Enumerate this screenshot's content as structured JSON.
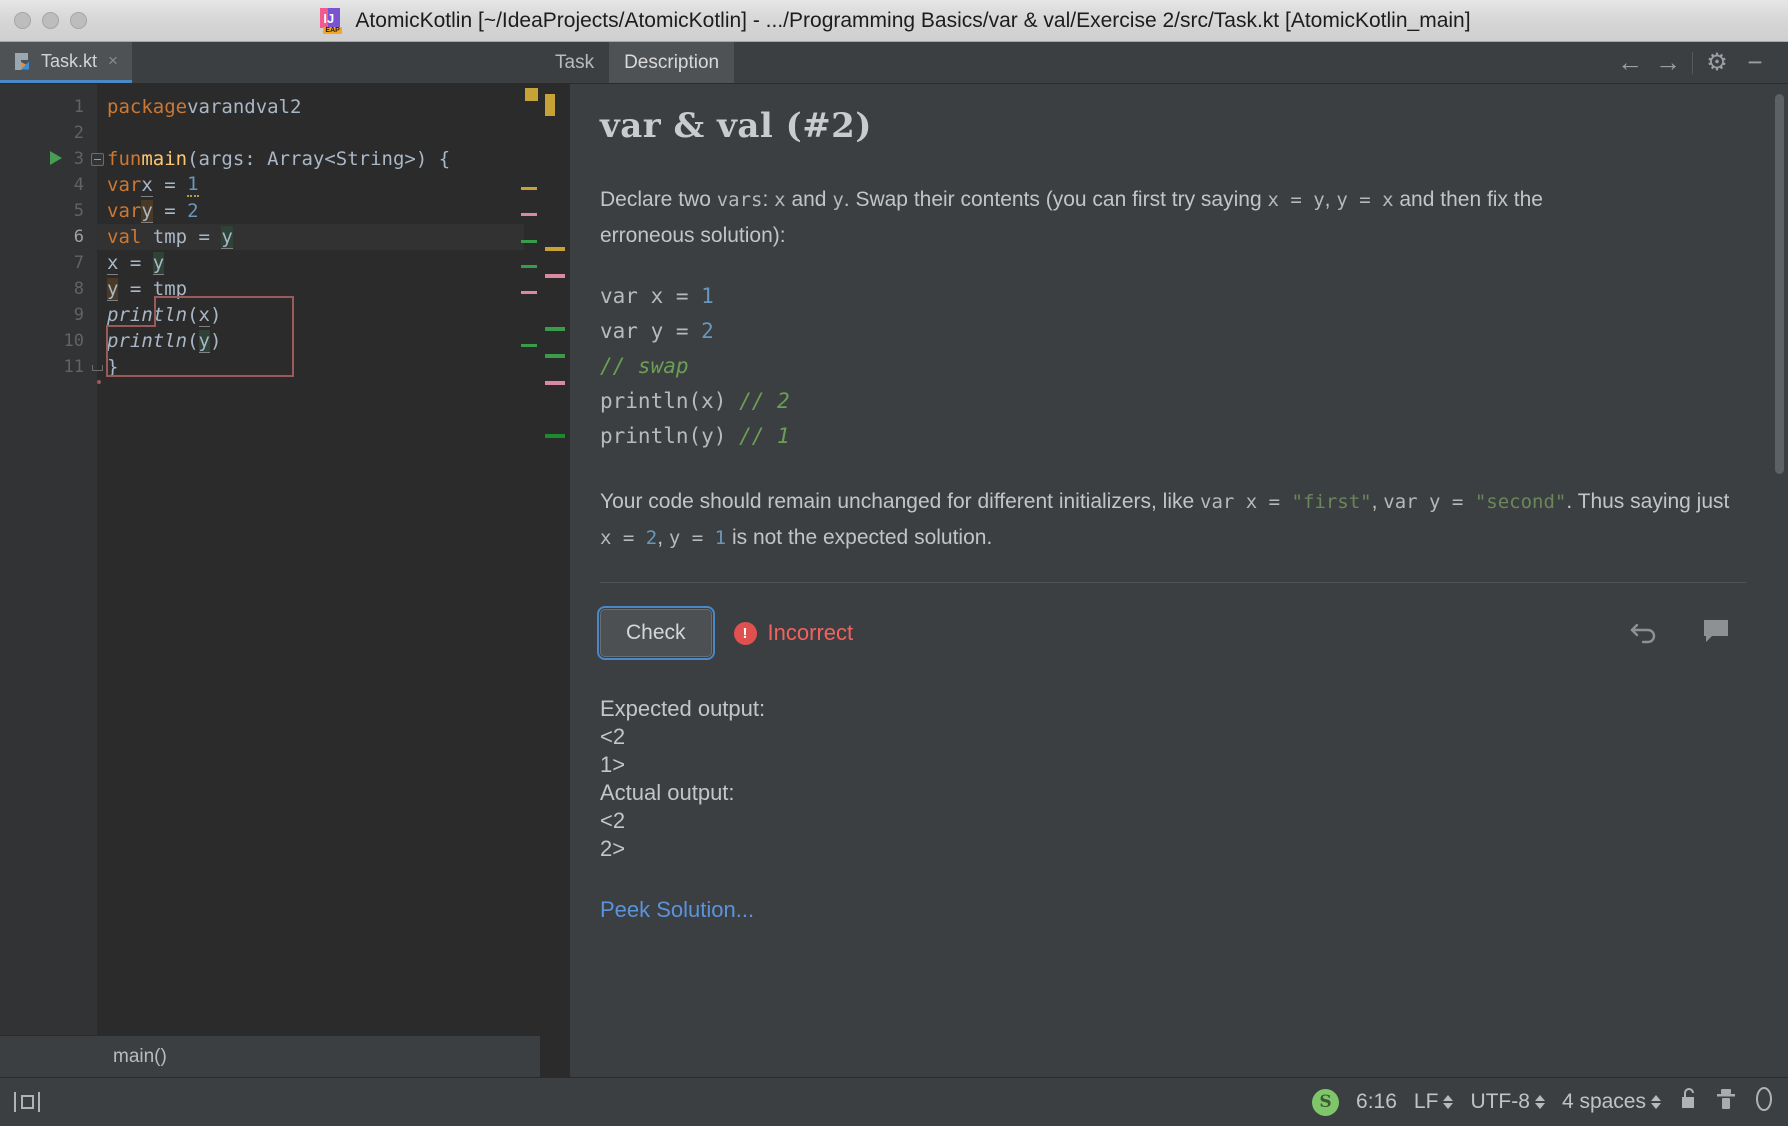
{
  "window": {
    "title": "AtomicKotlin [~/IdeaProjects/AtomicKotlin] - .../Programming Basics/var & val/Exercise 2/src/Task.kt [AtomicKotlin_main]",
    "app_icon": "intellij-idea-eap-icon",
    "traffic_lights": [
      "close-button",
      "minimize-button",
      "zoom-button"
    ]
  },
  "editor": {
    "tab": {
      "label": "Task.kt",
      "icon": "kotlin-file-icon",
      "close": "×"
    },
    "lines": [
      {
        "n": "1",
        "text": "package varandval2"
      },
      {
        "n": "2",
        "text": ""
      },
      {
        "n": "3",
        "text": "fun main(args: Array<String>) {"
      },
      {
        "n": "4",
        "text": "    var x = 1"
      },
      {
        "n": "5",
        "text": "    var y = 2"
      },
      {
        "n": "6",
        "text": "    val tmp = y"
      },
      {
        "n": "7",
        "text": "    x = y"
      },
      {
        "n": "8",
        "text": "    y = tmp"
      },
      {
        "n": "9",
        "text": "    println(x)"
      },
      {
        "n": "10",
        "text": "    println(y)"
      },
      {
        "n": "11",
        "text": "}"
      }
    ],
    "breadcrumb": "main()",
    "current_line": "6"
  },
  "task_panel": {
    "tabs": [
      {
        "label": "Task",
        "active": false
      },
      {
        "label": "Description",
        "active": true
      }
    ],
    "actions": [
      {
        "name": "back-arrow-icon",
        "glyph": "←"
      },
      {
        "name": "forward-arrow-icon",
        "glyph": "→"
      },
      {
        "name": "gear-icon",
        "glyph": "⚙"
      },
      {
        "name": "minimize-icon",
        "glyph": "−"
      }
    ],
    "title": "var & val (#2)",
    "paragraph1": {
      "p1": "Declare two ",
      "m1": "vars",
      "p2": ": ",
      "m2": "x",
      "p3": " and ",
      "m3": "y",
      "p4": ". Swap their contents (you can first try saying ",
      "m4": "x = y",
      "p5": ", ",
      "m5": "y = x",
      "p6": " and then fix the erroneous solution):"
    },
    "code_block": [
      {
        "code": "var x = ",
        "num": "1",
        "comment": ""
      },
      {
        "code": "var y = ",
        "num": "2",
        "comment": ""
      },
      {
        "code": "",
        "num": "",
        "comment": "// swap"
      },
      {
        "code": "println(x) ",
        "num": "",
        "comment": "// 2"
      },
      {
        "code": "println(y) ",
        "num": "",
        "comment": "// 1"
      }
    ],
    "paragraph2": {
      "p1": "Your code should remain unchanged for different initializers, like ",
      "m1": "var x = ",
      "s1": "\"first\"",
      "p2": ", ",
      "m2": "var y = ",
      "s2": "\"second\"",
      "p3": ". Thus saying just ",
      "m3": "x = ",
      "n1": "2",
      "p4": ", ",
      "m4": "y = ",
      "n2": "1",
      "p5": " is not the expected solution."
    },
    "check_button": "Check",
    "status": {
      "text": "Incorrect",
      "icon": "error-exclamation-icon",
      "color": "#f4615f"
    },
    "reset_icon": "undo-arrow-icon",
    "comment_icon": "comment-bubble-icon",
    "output": [
      "Expected output:",
      "<2",
      "1>",
      "Actual output:",
      "<2",
      "2>"
    ],
    "peek_solution": "Peek Solution..."
  },
  "statusbar": {
    "window_toggle_icon": "tool-window-toggle-icon",
    "kotlin_badge": "kotlin-status-icon",
    "caret_position": "6:16",
    "line_separator": "LF",
    "encoding": "UTF-8",
    "indent": "4 spaces",
    "lock_icon": "unlocked-padlock-icon",
    "inspector_icon": "inspection-detective-icon",
    "memory_icon": "memory-indicator-icon"
  },
  "colors": {
    "accent_blue": "#4a88c7",
    "error_red": "#f4615f",
    "link_blue": "#5b93db",
    "keyword_orange": "#cc7832",
    "number_blue": "#6897bb",
    "comment_green": "#6a9f55",
    "string_green": "#6a8759",
    "editor_bg": "#2b2b2b",
    "panel_bg": "#3c3f41"
  }
}
